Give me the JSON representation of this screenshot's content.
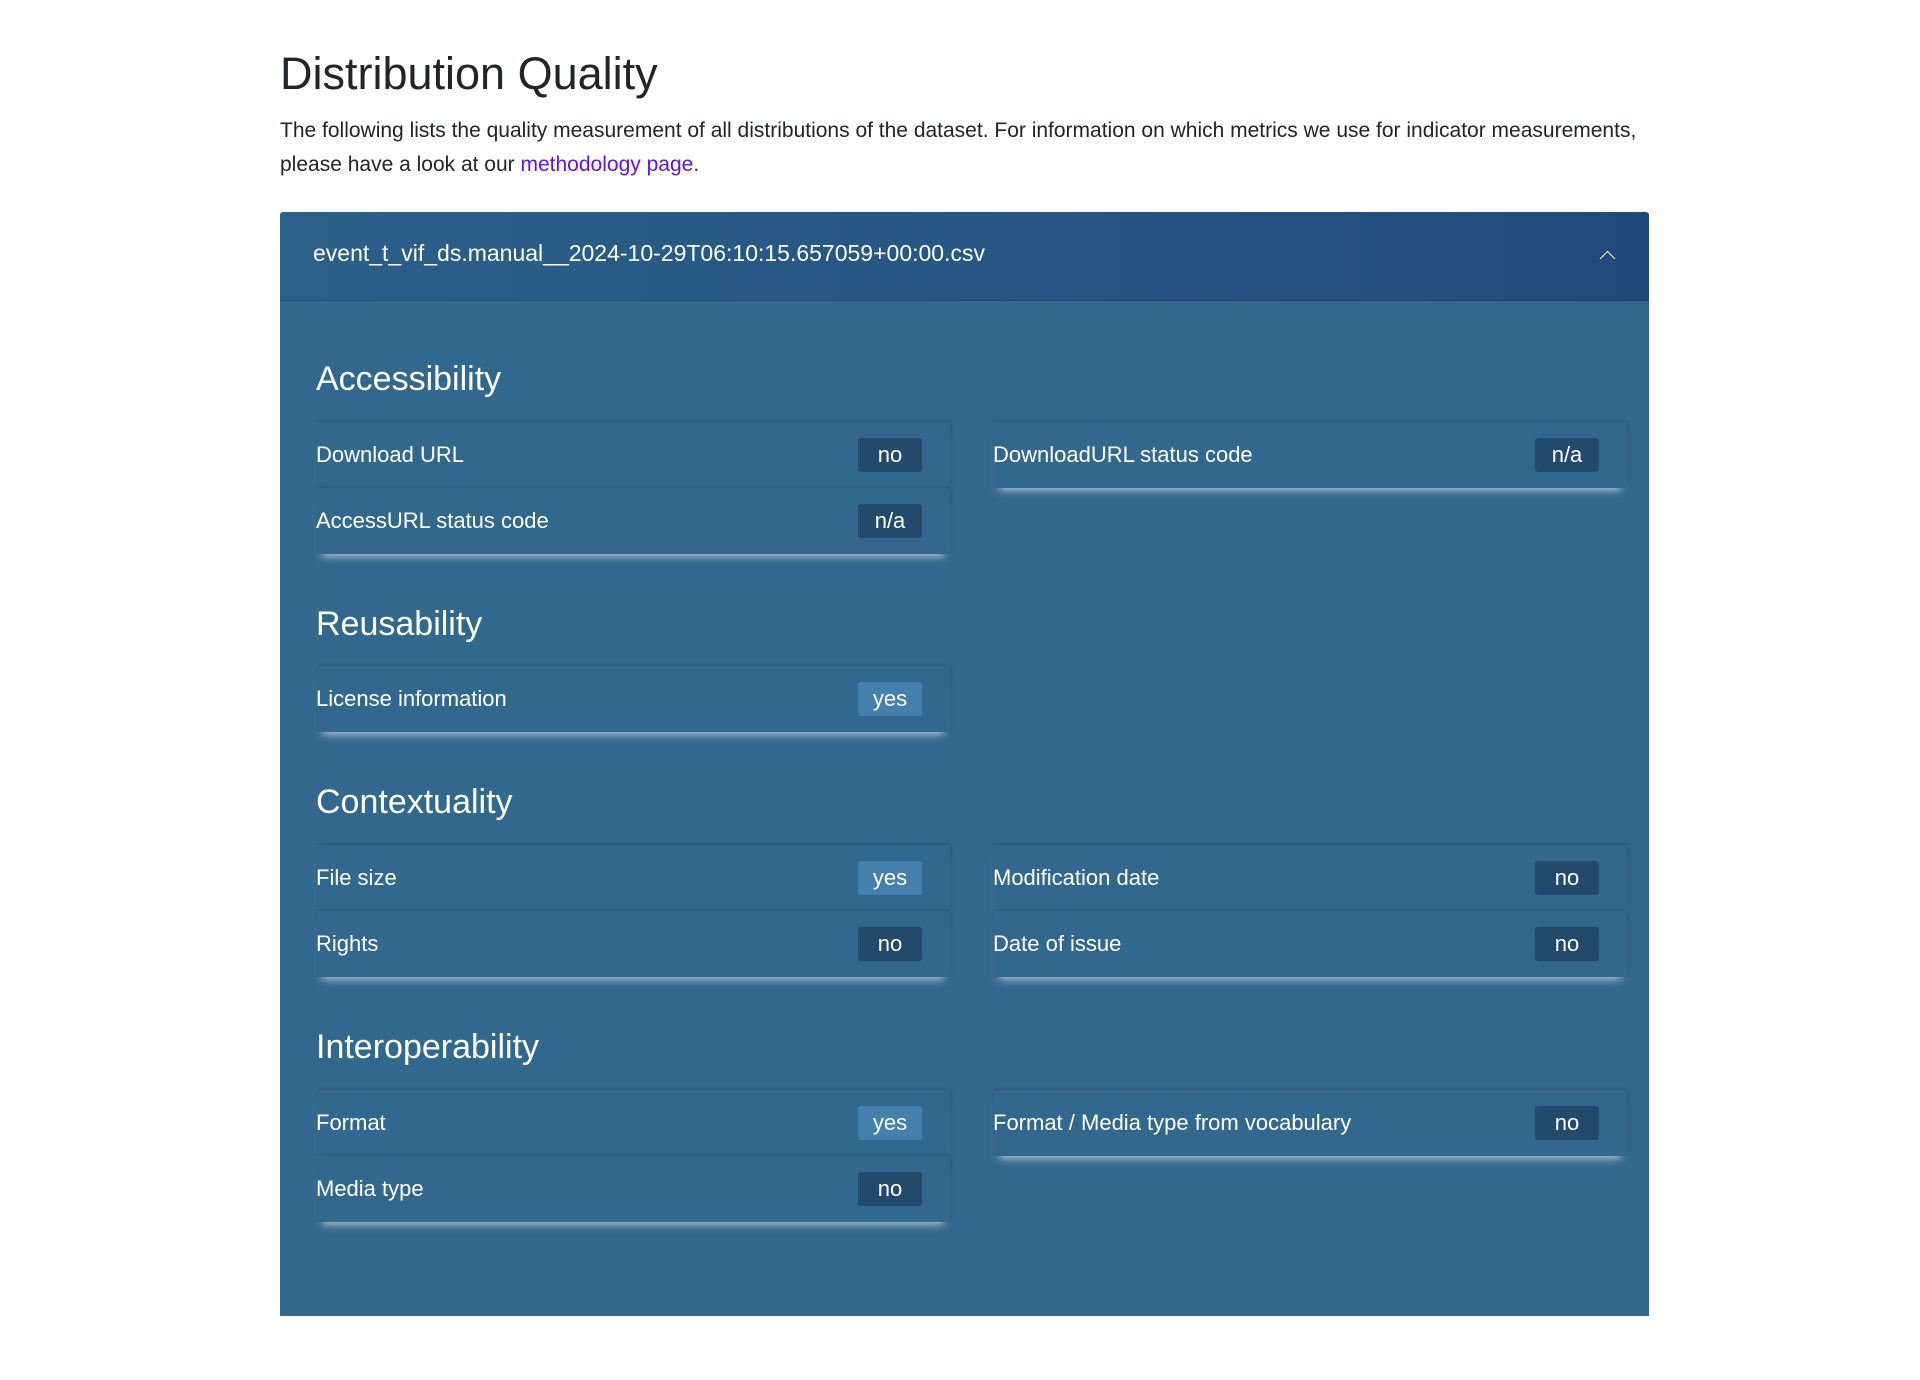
{
  "page": {
    "title": "Distribution Quality",
    "intro_text": "The following lists the quality measurement of all distributions of the dataset. For information on which metrics we use for indicator measurements, please have a look at our ",
    "intro_link": "methodology page",
    "intro_end": "."
  },
  "distribution": {
    "name": "event_t_vif_ds.manual__2024-10-29T06:10:15.657059+00:00.csv",
    "expanded": true,
    "toggle_icon": "chevron-up-icon"
  },
  "colors": {
    "header_bg": "#265584",
    "body_bg": "#33688e",
    "badge_negative": "#234a6b",
    "badge_positive": "#4580ad",
    "link": "#6610f2"
  },
  "sections": [
    {
      "title": "Accessibility",
      "metrics": [
        {
          "label": "Download URL",
          "value": "no"
        },
        {
          "label": "DownloadURL status code",
          "value": "n/a"
        },
        {
          "label": "AccessURL status code",
          "value": "n/a"
        }
      ]
    },
    {
      "title": "Reusability",
      "metrics": [
        {
          "label": "License information",
          "value": "yes"
        }
      ]
    },
    {
      "title": "Contextuality",
      "metrics": [
        {
          "label": "File size",
          "value": "yes"
        },
        {
          "label": "Modification date",
          "value": "no"
        },
        {
          "label": "Rights",
          "value": "no"
        },
        {
          "label": "Date of issue",
          "value": "no"
        }
      ]
    },
    {
      "title": "Interoperability",
      "metrics": [
        {
          "label": "Format",
          "value": "yes"
        },
        {
          "label": "Format / Media type from vocabulary",
          "value": "no"
        },
        {
          "label": "Media type",
          "value": "no"
        }
      ]
    }
  ]
}
